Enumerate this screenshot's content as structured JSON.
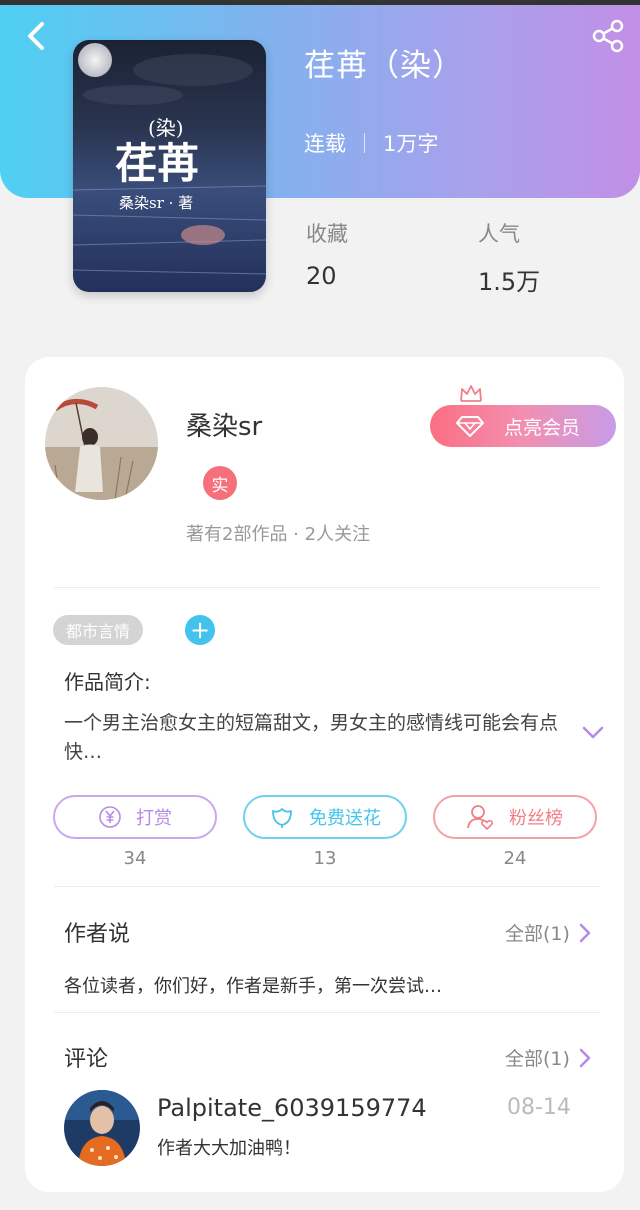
{
  "book": {
    "title": "荏苒（染）",
    "status": "连载",
    "word_count": "1万字",
    "stats": [
      {
        "label": "收藏",
        "value": "20"
      },
      {
        "label": "人气",
        "value": "1.5万"
      }
    ],
    "cover": {
      "title_small": "(染)",
      "title_big": "荏苒",
      "author_line": "桑染sr · 著"
    }
  },
  "author": {
    "name": "桑染sr",
    "badge": "实",
    "works_info": "著有2部作品 · 2人关注",
    "vip_label": "点亮会员"
  },
  "tags": [
    "都市言情"
  ],
  "add_tag_symbol": "+",
  "intro": {
    "title": "作品简介:",
    "text": "一个男主治愈女主的短篇甜文，男女主的感情线可能会有点快…"
  },
  "actions": [
    {
      "label": "打赏",
      "count": "34",
      "color": "#b48be6",
      "icon": "yen-icon"
    },
    {
      "label": "免费送花",
      "count": "13",
      "color": "#45c3ec",
      "icon": "flower-icon"
    },
    {
      "label": "粉丝榜",
      "count": "24",
      "color": "#f07f87",
      "icon": "fan-icon"
    }
  ],
  "author_say": {
    "title": "作者说",
    "more": "全部(1)",
    "text": "各位读者，你们好，作者是新手，第一次尝试…"
  },
  "comments": {
    "title": "评论",
    "more": "全部(1)",
    "items": [
      {
        "user": "Palpitate_6039159774",
        "date": "08-14",
        "text": "作者大大加油鸭！"
      }
    ]
  },
  "colors": {
    "header_start": "#4fd0f3",
    "header_end": "#c28fe6",
    "accent_purple": "#b48be6",
    "accent_blue": "#45c3ec",
    "accent_red": "#f07f87"
  }
}
